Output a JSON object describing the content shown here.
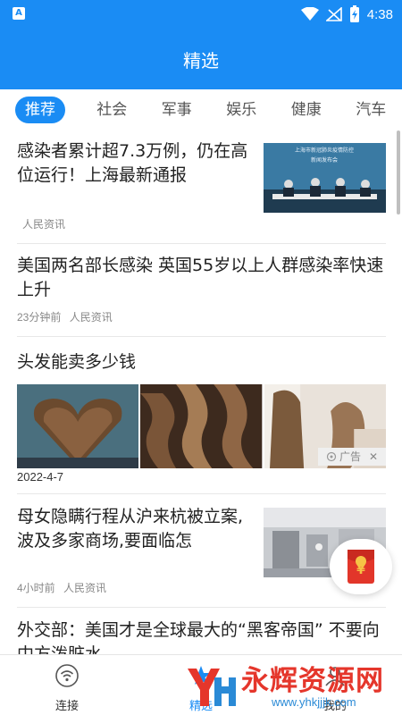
{
  "statusbar": {
    "app_icon_letter": "A",
    "time": "4:38"
  },
  "header": {
    "title": "精选"
  },
  "tabs": [
    {
      "label": "推荐",
      "active": true
    },
    {
      "label": "社会",
      "active": false
    },
    {
      "label": "军事",
      "active": false
    },
    {
      "label": "娱乐",
      "active": false
    },
    {
      "label": "健康",
      "active": false
    },
    {
      "label": "汽车",
      "active": false
    }
  ],
  "feed": {
    "items": [
      {
        "title": "感染者累计超7.3万例，仍在高位运行！上海最新通报",
        "time": "",
        "source": "人民资讯",
        "thumb_caption_1": "上海市新冠肺炎疫情防控",
        "thumb_caption_2": "新闻发布会"
      },
      {
        "title": "美国两名部长感染 英国55岁以上人群感染率快速上升",
        "time": "23分钟前",
        "source": "人民资讯"
      },
      {
        "title": "头发能卖多少钱",
        "date": "2022-4-7",
        "ad_label": "广告",
        "ad_close": "✕"
      },
      {
        "title": "母女隐瞒行程从沪来杭被立案,波及多家商场,要面临怎",
        "time": "4小时前",
        "source": "人民资讯"
      },
      {
        "title": "外交部：美国才是全球最大的“黑客帝国” 不要向中方泼脏水"
      }
    ]
  },
  "redpacket": {
    "symbol": "¥"
  },
  "bottom_nav": [
    {
      "label": "连接",
      "icon": "wifi-icon"
    },
    {
      "label": "精选",
      "icon": "star-icon"
    },
    {
      "label": "我的",
      "icon": "user-icon"
    }
  ],
  "watermark": {
    "main": "永辉资源网",
    "sub": "www.yhkjjjk.com"
  },
  "colors": {
    "primary": "#1a8cf4",
    "red": "#e2362a",
    "watermark_red": "#e5362b",
    "watermark_blue": "#2a8ad6"
  }
}
